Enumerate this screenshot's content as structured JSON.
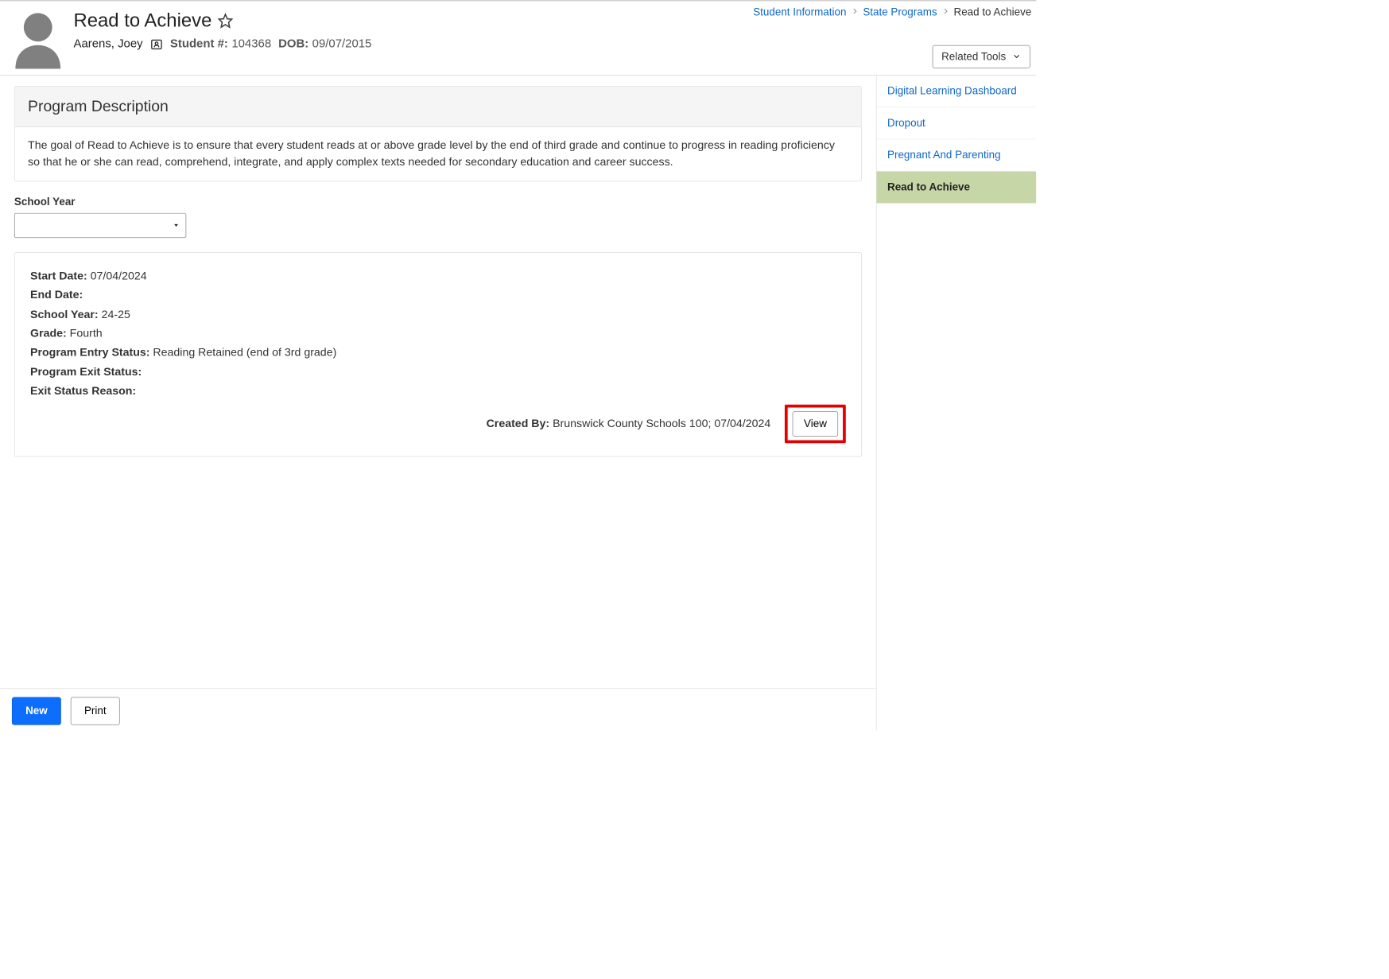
{
  "header": {
    "title": "Read to Achieve",
    "student_name": "Aarens, Joey",
    "student_num_label": "Student #:",
    "student_num": "104368",
    "dob_label": "DOB:",
    "dob": "09/07/2015"
  },
  "breadcrumb": {
    "item1": "Student Information",
    "item2": "State Programs",
    "current": "Read to Achieve"
  },
  "related_tools_label": "Related Tools",
  "program_description": {
    "heading": "Program Description",
    "text": "The goal of Read to Achieve is to ensure that every student reads at or above grade level by the end of third grade and continue to progress in reading proficiency so that he or she can read, comprehend, integrate, and apply complex texts needed for secondary education and career success."
  },
  "school_year_label": "School Year",
  "school_year_value": "",
  "record": {
    "start_date_label": "Start Date:",
    "start_date": "07/04/2024",
    "end_date_label": "End Date:",
    "end_date": "",
    "school_year_label": "School Year:",
    "school_year": "24-25",
    "grade_label": "Grade:",
    "grade": "Fourth",
    "entry_status_label": "Program Entry Status:",
    "entry_status": "Reading Retained (end of 3rd grade)",
    "exit_status_label": "Program Exit Status:",
    "exit_status": "",
    "exit_reason_label": "Exit Status Reason:",
    "exit_reason": "",
    "created_by_label": "Created By:",
    "created_by": "Brunswick County Schools 100; 07/04/2024",
    "view_label": "View"
  },
  "buttons": {
    "new": "New",
    "print": "Print"
  },
  "side_items": {
    "dld": "Digital Learning Dashboard",
    "dropout": "Dropout",
    "pap": "Pregnant And Parenting",
    "rta": "Read to Achieve"
  }
}
